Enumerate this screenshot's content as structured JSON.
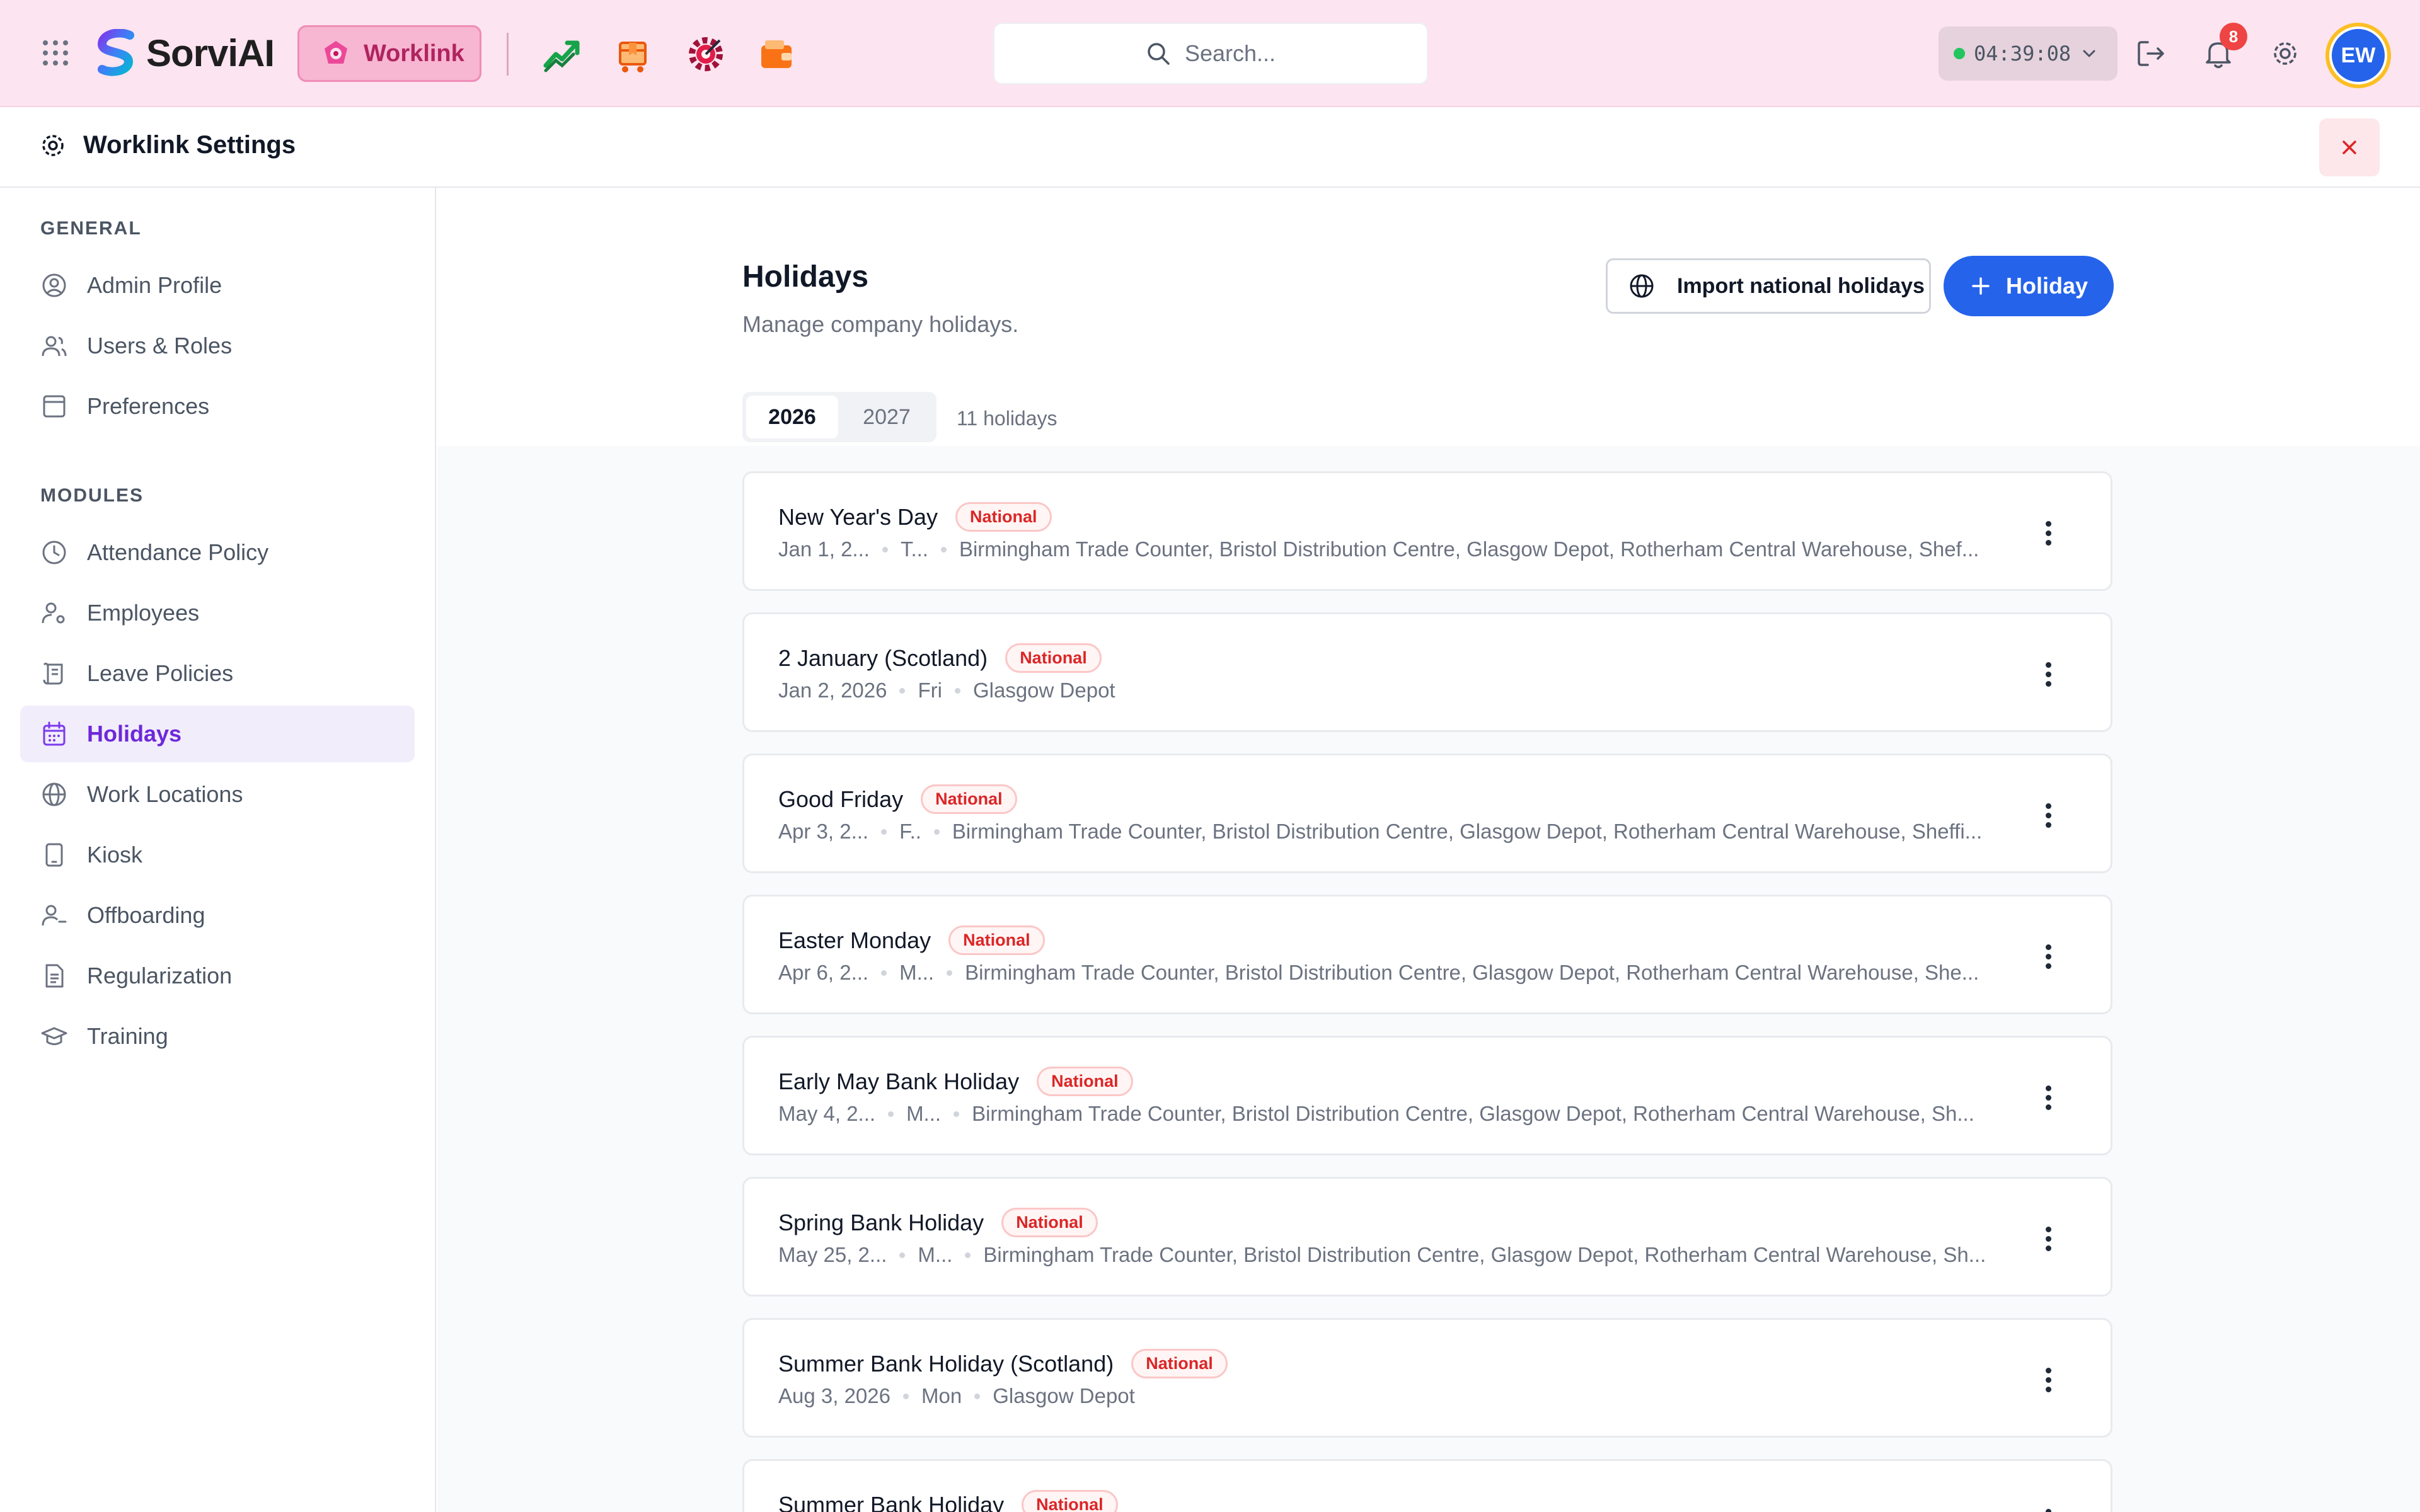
{
  "topbar": {
    "brand": "SorviAI",
    "active_app": "Worklink",
    "apps": [
      {
        "icon": "growth-chart-icon"
      },
      {
        "icon": "package-icon"
      },
      {
        "icon": "gear-target-icon"
      },
      {
        "icon": "wallet-icon"
      }
    ],
    "search_placeholder": "Search...",
    "timer": "04:39:08",
    "notification_count": "8",
    "avatar_initials": "EW",
    "colors": {
      "bar_bg": "#fce4f0",
      "accent_pink": "#f7b6d2",
      "avatar_blue": "#2563eb",
      "badge_red": "#ef4444"
    }
  },
  "settings": {
    "title": "Worklink Settings"
  },
  "sidebar": {
    "general_label": "GENERAL",
    "general_items": [
      {
        "label": "Admin Profile",
        "icon": "user-circle-icon"
      },
      {
        "label": "Users & Roles",
        "icon": "users-icon"
      },
      {
        "label": "Preferences",
        "icon": "panel-icon"
      }
    ],
    "modules_label": "MODULES",
    "module_items": [
      {
        "label": "Attendance Policy",
        "icon": "clock-icon"
      },
      {
        "label": "Employees",
        "icon": "user-gear-icon"
      },
      {
        "label": "Leave Policies",
        "icon": "scroll-icon"
      },
      {
        "label": "Holidays",
        "icon": "calendar-icon",
        "active": true
      },
      {
        "label": "Work Locations",
        "icon": "globe-icon"
      },
      {
        "label": "Kiosk",
        "icon": "tablet-icon"
      },
      {
        "label": "Offboarding",
        "icon": "user-minus-icon"
      },
      {
        "label": "Regularization",
        "icon": "document-icon"
      },
      {
        "label": "Training",
        "icon": "graduation-cap-icon"
      }
    ]
  },
  "main": {
    "title": "Holidays",
    "subtitle": "Manage company holidays.",
    "import_label": "Import national holidays",
    "add_label": "Holiday",
    "years": [
      "2026",
      "2027"
    ],
    "active_year": "2026",
    "count_label": "11 holidays",
    "holidays": [
      {
        "name": "New Year's Day",
        "tag": "National",
        "date": "Jan 1, 2...",
        "day": "T...",
        "locations": "Birmingham Trade Counter, Bristol Distribution Centre, Glasgow Depot, Rotherham Central Warehouse, Shef..."
      },
      {
        "name": "2 January (Scotland)",
        "tag": "National",
        "date": "Jan 2, 2026",
        "day": "Fri",
        "locations": "Glasgow Depot"
      },
      {
        "name": "Good Friday",
        "tag": "National",
        "date": "Apr 3, 2...",
        "day": "F..",
        "locations": "Birmingham Trade Counter, Bristol Distribution Centre, Glasgow Depot, Rotherham Central Warehouse, Sheffi..."
      },
      {
        "name": "Easter Monday",
        "tag": "National",
        "date": "Apr 6, 2...",
        "day": "M...",
        "locations": "Birmingham Trade Counter, Bristol Distribution Centre, Glasgow Depot, Rotherham Central Warehouse, She..."
      },
      {
        "name": "Early May Bank Holiday",
        "tag": "National",
        "date": "May 4, 2...",
        "day": "M...",
        "locations": "Birmingham Trade Counter, Bristol Distribution Centre, Glasgow Depot, Rotherham Central Warehouse, Sh..."
      },
      {
        "name": "Spring Bank Holiday",
        "tag": "National",
        "date": "May 25, 2...",
        "day": "M...",
        "locations": "Birmingham Trade Counter, Bristol Distribution Centre, Glasgow Depot, Rotherham Central Warehouse, Sh..."
      },
      {
        "name": "Summer Bank Holiday (Scotland)",
        "tag": "National",
        "date": "Aug 3, 2026",
        "day": "Mon",
        "locations": "Glasgow Depot"
      },
      {
        "name": "Summer Bank Holiday",
        "tag": "National",
        "date": "",
        "day": "",
        "locations": ""
      }
    ]
  }
}
